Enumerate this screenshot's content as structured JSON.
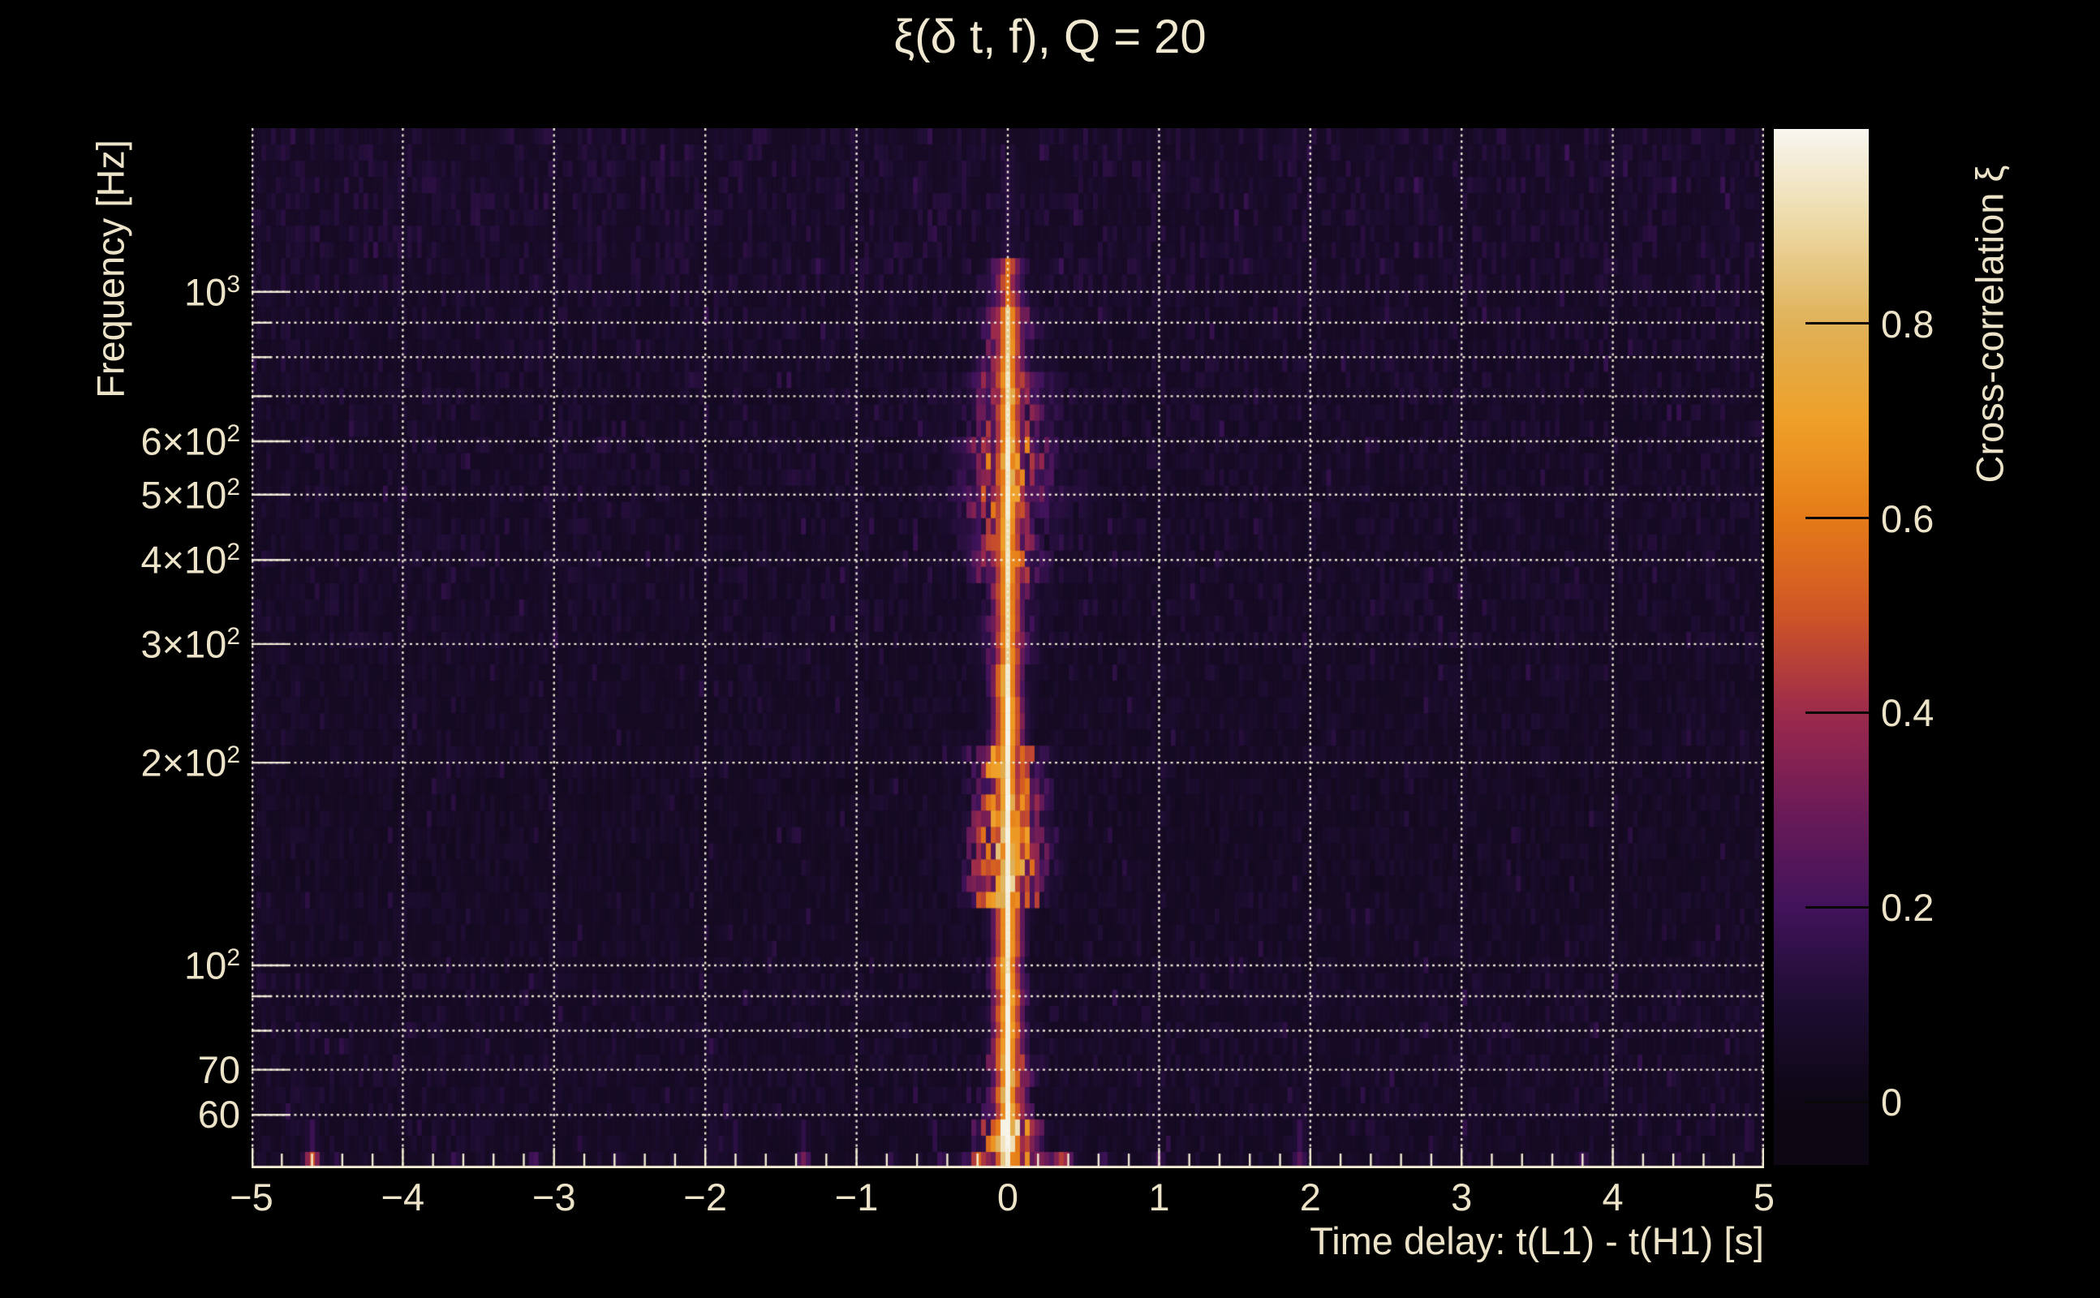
{
  "title": "ξ(δ t, f), Q = 20",
  "axes": {
    "x_label": "Time delay: t(L1) - t(H1) [s]",
    "y_label": "Frequency [Hz]",
    "colorbar_label": "Cross-correlation ξ"
  },
  "colors": {
    "background": "#000000",
    "text": "#ece3c8",
    "gridline": "#f5eed6",
    "axis_line": "#f3ecd2"
  },
  "chart_data": {
    "type": "heatmap",
    "title": "ξ(δ t, f), Q = 20",
    "xlabel": "Time delay: t(L1) - t(H1) [s]",
    "ylabel": "Frequency [Hz]",
    "colorbar_label": "Cross-correlation ξ",
    "x_range_s": [
      -5,
      5
    ],
    "x_minor_tick_step_s": 0.2,
    "y_range_hz": [
      50,
      1750
    ],
    "y_scale": "log",
    "grid": "dotted cream gridlines at integer time delays and at 60,70,80,90,100,200...1000 Hz",
    "colorbar_range": [
      -0.065,
      1.0
    ],
    "x_ticks": [
      {
        "label": "−5",
        "t": -5
      },
      {
        "label": "−4",
        "t": -4
      },
      {
        "label": "−3",
        "t": -3
      },
      {
        "label": "−2",
        "t": -2
      },
      {
        "label": "−1",
        "t": -1
      },
      {
        "label": "0",
        "t": 0
      },
      {
        "label": "1",
        "t": 1
      },
      {
        "label": "2",
        "t": 2
      },
      {
        "label": "3",
        "t": 3
      },
      {
        "label": "4",
        "t": 4
      },
      {
        "label": "5",
        "t": 5
      }
    ],
    "y_ticks": [
      {
        "main": "10",
        "sup": "3",
        "f": 1000
      },
      {
        "main": "6×10",
        "sup": "2",
        "f": 600
      },
      {
        "main": "5×10",
        "sup": "2",
        "f": 500
      },
      {
        "main": "4×10",
        "sup": "2",
        "f": 400
      },
      {
        "main": "3×10",
        "sup": "2",
        "f": 300
      },
      {
        "main": "2×10",
        "sup": "2",
        "f": 200
      },
      {
        "main": "10",
        "sup": "2",
        "f": 100
      },
      {
        "main": "70",
        "sup": "",
        "f": 70
      },
      {
        "main": "60",
        "sup": "",
        "f": 60
      }
    ],
    "grid_freqs_hz": [
      60,
      70,
      80,
      90,
      100,
      200,
      300,
      400,
      500,
      600,
      700,
      800,
      900,
      1000
    ],
    "minor_unlabeled_freqs_hz": [
      80,
      90,
      700,
      800,
      900
    ],
    "colorbar_ticks": [
      {
        "label": "0.8",
        "v": 0.8
      },
      {
        "label": "0.6",
        "v": 0.6
      },
      {
        "label": "0.4",
        "v": 0.4
      },
      {
        "label": "0.2",
        "v": 0.2
      },
      {
        "label": "0",
        "v": 0.0
      }
    ],
    "colormap_stops": [
      [
        0.0,
        "#0d0714"
      ],
      [
        0.1,
        "#1d0d31"
      ],
      [
        0.2,
        "#41135b"
      ],
      [
        0.3,
        "#6b1b57"
      ],
      [
        0.4,
        "#9c2a4c"
      ],
      [
        0.5,
        "#cf5526"
      ],
      [
        0.6,
        "#e57b18"
      ],
      [
        0.7,
        "#efa028"
      ],
      [
        0.8,
        "#dfb057"
      ],
      [
        0.9,
        "#ecd9a4"
      ],
      [
        1.0,
        "#f8f6f0"
      ]
    ],
    "background_texture": "dark purple noise (ξ ≈ 0 – 0.1) in vertical streaks on log-spaced rows",
    "noise_bands": [
      [
        1000,
        1750,
        0.055,
        0.085
      ],
      [
        600,
        1000,
        0.05,
        0.075
      ],
      [
        300,
        600,
        0.05,
        0.07
      ],
      [
        200,
        300,
        0.045,
        0.06
      ],
      [
        130,
        200,
        0.042,
        0.055
      ],
      [
        100,
        130,
        0.045,
        0.06
      ],
      [
        60,
        100,
        0.05,
        0.065
      ],
      [
        50,
        60,
        0.045,
        0.06
      ]
    ],
    "ridge": {
      "center_t_s": 0.0,
      "description": "Narrow near-white ridge of high cross-correlation at zero time delay spanning ~55–1500 Hz, with orange high-ξ lobes around it; strongest/widest near 54–72 Hz, 125–210 Hz and 470–950 Hz; fades above ~1100 Hz",
      "bands": [
        [
          1600,
          1750,
          0.0,
          8,
          0.0,
          20,
          0.02
        ],
        [
          1100,
          1600,
          0.15,
          7,
          0.05,
          22,
          0.05
        ],
        [
          950,
          1100,
          0.6,
          9,
          0.32,
          26,
          0.1
        ],
        [
          780,
          950,
          0.88,
          9,
          0.48,
          30,
          0.14
        ],
        [
          620,
          780,
          0.93,
          9,
          0.42,
          46,
          0.16
        ],
        [
          470,
          620,
          0.96,
          10,
          0.56,
          50,
          0.16
        ],
        [
          360,
          470,
          0.93,
          9,
          0.48,
          42,
          0.14
        ],
        [
          280,
          360,
          0.9,
          8,
          0.42,
          30,
          0.12
        ],
        [
          210,
          280,
          0.99,
          8,
          0.46,
          22,
          0.1
        ],
        [
          160,
          210,
          0.99,
          9,
          0.62,
          42,
          0.12
        ],
        [
          125,
          160,
          0.98,
          10,
          0.68,
          46,
          0.1
        ],
        [
          95,
          125,
          0.96,
          8,
          0.3,
          18,
          0.06
        ],
        [
          72,
          95,
          0.99,
          8,
          0.46,
          22,
          0.06
        ],
        [
          60,
          72,
          1.0,
          9,
          0.52,
          28,
          0.05
        ],
        [
          54,
          60,
          1.0,
          10,
          0.75,
          36,
          0.05
        ],
        [
          50,
          54,
          0.98,
          9,
          0.62,
          52,
          0.05
        ]
      ]
    },
    "bottom_smears": [
      {
        "band": 2,
        "t": -4.6,
        "v": 0.5,
        "sigma": 10
      },
      {
        "band": 2,
        "t": -3.66,
        "v": 0.18,
        "sigma": 8
      },
      {
        "band": 2,
        "t": -3.13,
        "v": 0.22,
        "sigma": 9
      },
      {
        "band": 2,
        "t": -2.59,
        "v": 0.14,
        "sigma": 8
      },
      {
        "band": 2,
        "t": -1.8,
        "v": 0.12,
        "sigma": 8
      },
      {
        "band": 2,
        "t": -1.35,
        "v": 0.32,
        "sigma": 9
      },
      {
        "band": 2,
        "t": -0.77,
        "v": 0.16,
        "sigma": 8
      },
      {
        "band": 2,
        "t": -0.44,
        "v": 0.2,
        "sigma": 8
      },
      {
        "band": 2,
        "t": 0.36,
        "v": 0.45,
        "sigma": 14
      },
      {
        "band": 2,
        "t": 0.63,
        "v": 0.2,
        "sigma": 8
      },
      {
        "band": 2,
        "t": 1.0,
        "v": 0.22,
        "sigma": 8
      },
      {
        "band": 2,
        "t": 1.93,
        "v": 0.26,
        "sigma": 9
      },
      {
        "band": 2,
        "t": 2.45,
        "v": 0.12,
        "sigma": 8
      },
      {
        "band": 2,
        "t": 3.05,
        "v": 0.12,
        "sigma": 8
      },
      {
        "band": 2,
        "t": 3.8,
        "v": 0.2,
        "sigma": 9
      },
      {
        "band": 2,
        "t": 4.43,
        "v": 0.14,
        "sigma": 8
      },
      {
        "band": 2,
        "t": 4.84,
        "v": 0.12,
        "sigma": 8
      },
      {
        "band": 1,
        "t": -4.6,
        "v": 0.48,
        "sigma": 10
      },
      {
        "band": 1,
        "t": -3.66,
        "v": 0.14,
        "sigma": 8
      },
      {
        "band": 1,
        "t": -1.35,
        "v": 0.28,
        "sigma": 9
      },
      {
        "band": 1,
        "t": 0.4,
        "v": 0.35,
        "sigma": 12
      },
      {
        "band": 1,
        "t": 1.93,
        "v": 0.22,
        "sigma": 9
      },
      {
        "band": 1,
        "t": 3.8,
        "v": 0.14,
        "sigma": 8
      },
      {
        "band": 1,
        "t": 4.95,
        "v": 0.22,
        "sigma": 9
      },
      {
        "band": 0,
        "t": -4.6,
        "v": 0.18,
        "sigma": 8
      },
      {
        "band": 0,
        "t": -1.8,
        "v": 0.14,
        "sigma": 8
      },
      {
        "band": 0,
        "t": -1.35,
        "v": 0.15,
        "sigma": 8
      },
      {
        "band": 0,
        "t": 1.93,
        "v": 0.18,
        "sigma": 8
      },
      {
        "band": 0,
        "t": 4.9,
        "v": 0.15,
        "sigma": 8
      }
    ],
    "noise_seed": 1337
  }
}
